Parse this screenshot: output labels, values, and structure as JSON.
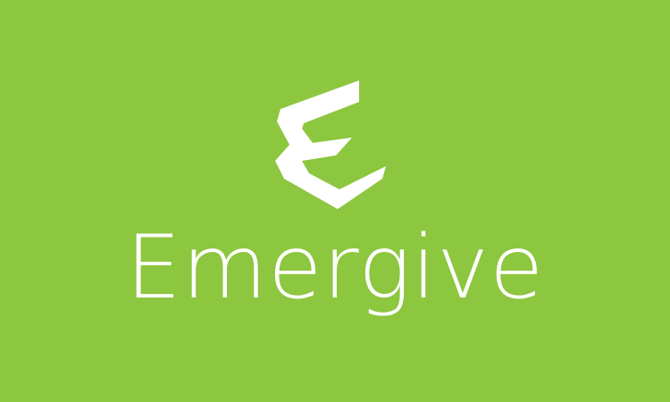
{
  "brand": {
    "name": "Emergive",
    "logo_icon": "stylized-e-icon"
  },
  "colors": {
    "background": "#8dc63f",
    "foreground": "#ffffff"
  }
}
